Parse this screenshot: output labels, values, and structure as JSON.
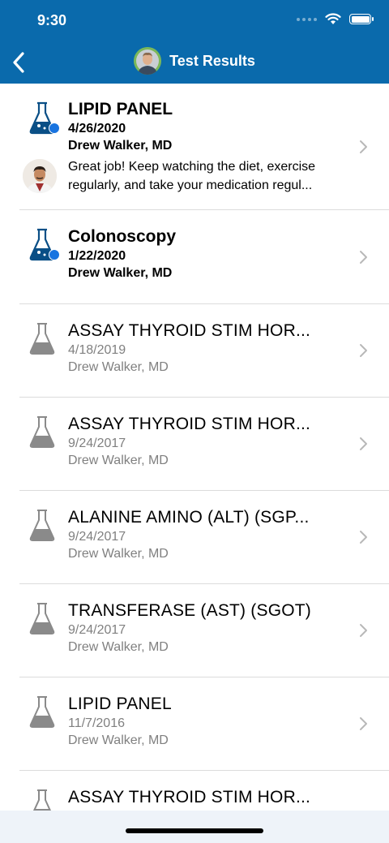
{
  "status": {
    "time": "9:30"
  },
  "nav": {
    "title": "Test Results"
  },
  "results": [
    {
      "title": "LIPID PANEL",
      "date": "4/26/2020",
      "provider": "Drew Walker, MD",
      "unread": true,
      "comment": "Great job! Keep watching the diet, exercise regularly, and take your medication regul..."
    },
    {
      "title": "Colonoscopy",
      "date": "1/22/2020",
      "provider": "Drew Walker, MD",
      "unread": true
    },
    {
      "title": "ASSAY THYROID STIM HOR...",
      "date": "4/18/2019",
      "provider": "Drew Walker, MD",
      "unread": false
    },
    {
      "title": "ASSAY THYROID STIM HOR...",
      "date": "9/24/2017",
      "provider": "Drew Walker, MD",
      "unread": false
    },
    {
      "title": "ALANINE AMINO (ALT) (SGP...",
      "date": "9/24/2017",
      "provider": "Drew Walker, MD",
      "unread": false
    },
    {
      "title": "TRANSFERASE (AST) (SGOT)",
      "date": "9/24/2017",
      "provider": "Drew Walker, MD",
      "unread": false
    },
    {
      "title": "LIPID PANEL",
      "date": "11/7/2016",
      "provider": "Drew Walker, MD",
      "unread": false
    },
    {
      "title": "ASSAY THYROID STIM HOR...",
      "date": "",
      "provider": "",
      "unread": false
    }
  ],
  "icons": {
    "back": "chevron-left-icon",
    "flask_unread": "flask-icon-blue",
    "flask_read": "flask-icon-gray",
    "row_chevron": "chevron-right-icon"
  },
  "colors": {
    "header": "#0a6aac",
    "unread_dot": "#1874e0",
    "read_text": "#808080",
    "flask_blue": "#0a4f86",
    "flask_gray": "#8a8a8a"
  }
}
